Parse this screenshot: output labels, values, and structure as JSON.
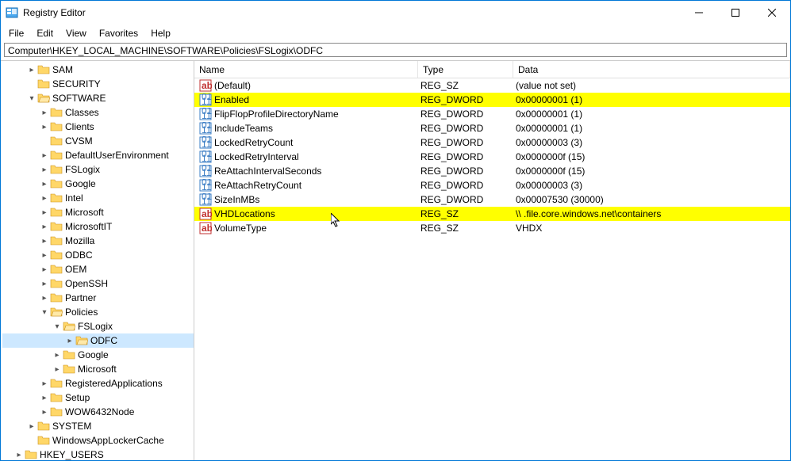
{
  "window": {
    "title": "Registry Editor"
  },
  "menu": {
    "file": "File",
    "edit": "Edit",
    "view": "View",
    "favorites": "Favorites",
    "help": "Help"
  },
  "address": "Computer\\HKEY_LOCAL_MACHINE\\SOFTWARE\\Policies\\FSLogix\\ODFC",
  "columns": {
    "name": "Name",
    "type": "Type",
    "data": "Data"
  },
  "tree": [
    {
      "indent": 1,
      "arrow": ">",
      "label": "SAM"
    },
    {
      "indent": 1,
      "arrow": "",
      "label": "SECURITY"
    },
    {
      "indent": 1,
      "arrow": "v",
      "label": "SOFTWARE"
    },
    {
      "indent": 2,
      "arrow": ">",
      "label": "Classes"
    },
    {
      "indent": 2,
      "arrow": ">",
      "label": "Clients"
    },
    {
      "indent": 2,
      "arrow": "",
      "label": "CVSM"
    },
    {
      "indent": 2,
      "arrow": ">",
      "label": "DefaultUserEnvironment"
    },
    {
      "indent": 2,
      "arrow": ">",
      "label": "FSLogix"
    },
    {
      "indent": 2,
      "arrow": ">",
      "label": "Google"
    },
    {
      "indent": 2,
      "arrow": ">",
      "label": "Intel"
    },
    {
      "indent": 2,
      "arrow": ">",
      "label": "Microsoft"
    },
    {
      "indent": 2,
      "arrow": ">",
      "label": "MicrosoftIT"
    },
    {
      "indent": 2,
      "arrow": ">",
      "label": "Mozilla"
    },
    {
      "indent": 2,
      "arrow": ">",
      "label": "ODBC"
    },
    {
      "indent": 2,
      "arrow": ">",
      "label": "OEM"
    },
    {
      "indent": 2,
      "arrow": ">",
      "label": "OpenSSH"
    },
    {
      "indent": 2,
      "arrow": ">",
      "label": "Partner"
    },
    {
      "indent": 2,
      "arrow": "v",
      "label": "Policies"
    },
    {
      "indent": 3,
      "arrow": "v",
      "label": "FSLogix"
    },
    {
      "indent": 4,
      "arrow": ">",
      "label": "ODFC",
      "selected": true
    },
    {
      "indent": 3,
      "arrow": ">",
      "label": "Google"
    },
    {
      "indent": 3,
      "arrow": ">",
      "label": "Microsoft"
    },
    {
      "indent": 2,
      "arrow": ">",
      "label": "RegisteredApplications"
    },
    {
      "indent": 2,
      "arrow": ">",
      "label": "Setup"
    },
    {
      "indent": 2,
      "arrow": ">",
      "label": "WOW6432Node"
    },
    {
      "indent": 1,
      "arrow": ">",
      "label": "SYSTEM"
    },
    {
      "indent": 1,
      "arrow": "",
      "label": "WindowsAppLockerCache"
    },
    {
      "indent": 0,
      "arrow": ">",
      "label": "HKEY_USERS"
    }
  ],
  "values": [
    {
      "icon": "sz",
      "name": "(Default)",
      "type": "REG_SZ",
      "data": "(value not set)",
      "hl": false
    },
    {
      "icon": "dw",
      "name": "Enabled",
      "type": "REG_DWORD",
      "data": "0x00000001 (1)",
      "hl": true
    },
    {
      "icon": "dw",
      "name": "FlipFlopProfileDirectoryName",
      "type": "REG_DWORD",
      "data": "0x00000001 (1)",
      "hl": false
    },
    {
      "icon": "dw",
      "name": "IncludeTeams",
      "type": "REG_DWORD",
      "data": "0x00000001 (1)",
      "hl": false
    },
    {
      "icon": "dw",
      "name": "LockedRetryCount",
      "type": "REG_DWORD",
      "data": "0x00000003 (3)",
      "hl": false
    },
    {
      "icon": "dw",
      "name": "LockedRetryInterval",
      "type": "REG_DWORD",
      "data": "0x0000000f (15)",
      "hl": false
    },
    {
      "icon": "dw",
      "name": "ReAttachIntervalSeconds",
      "type": "REG_DWORD",
      "data": "0x0000000f (15)",
      "hl": false
    },
    {
      "icon": "dw",
      "name": "ReAttachRetryCount",
      "type": "REG_DWORD",
      "data": "0x00000003 (3)",
      "hl": false
    },
    {
      "icon": "dw",
      "name": "SizeInMBs",
      "type": "REG_DWORD",
      "data": "0x00007530 (30000)",
      "hl": false
    },
    {
      "icon": "sz",
      "name": "VHDLocations",
      "type": "REG_SZ",
      "data": "\\\\                                        .file.core.windows.net\\containers",
      "hl": true
    },
    {
      "icon": "sz",
      "name": "VolumeType",
      "type": "REG_SZ",
      "data": "VHDX",
      "hl": false
    }
  ]
}
